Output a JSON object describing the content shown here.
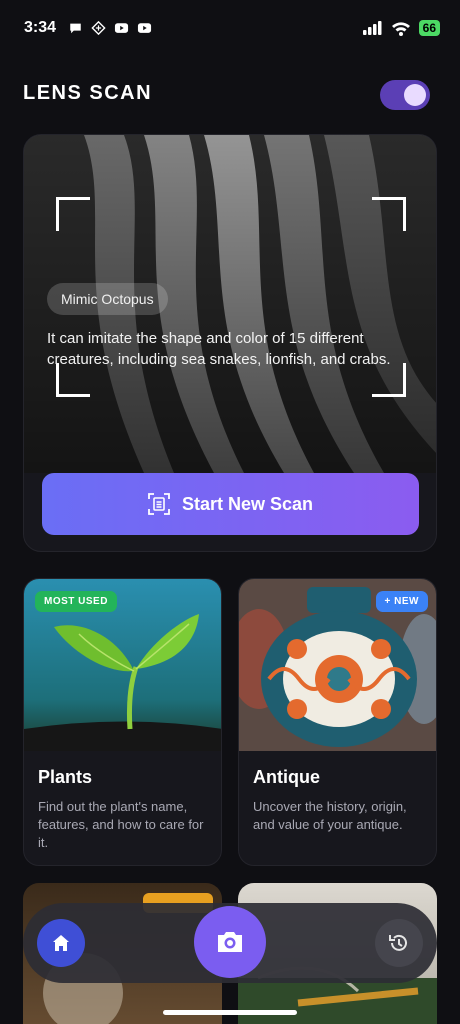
{
  "status_bar": {
    "time": "3:34",
    "battery": "66",
    "icons": [
      "chat-icon",
      "app-icon",
      "youtube-icon",
      "youtube-icon",
      "signal-icon",
      "wifi-icon",
      "battery-icon"
    ]
  },
  "header": {
    "title": "LENS SCAN",
    "toggle_on": true
  },
  "hero": {
    "tag": "Mimic Octopus",
    "text": "It can imitate the shape and color of 15 different creatures, including sea snakes, lionfish, and crabs.",
    "scan_button": "Start New Scan"
  },
  "categories": [
    {
      "badge": "MOST USED",
      "title": "Plants",
      "description": "Find out the plant's name, features, and how to care for it."
    },
    {
      "badge": "+ NEW",
      "title": "Antique",
      "description": "Uncover the history, origin, and value of your antique."
    }
  ],
  "nav": {
    "items": [
      "home-icon",
      "camera-icon",
      "history-icon"
    ]
  },
  "colors": {
    "background": "#0f0f13",
    "accent": "#7b5df0",
    "badge_green": "#23b45a",
    "badge_blue": "#3b82f6"
  }
}
